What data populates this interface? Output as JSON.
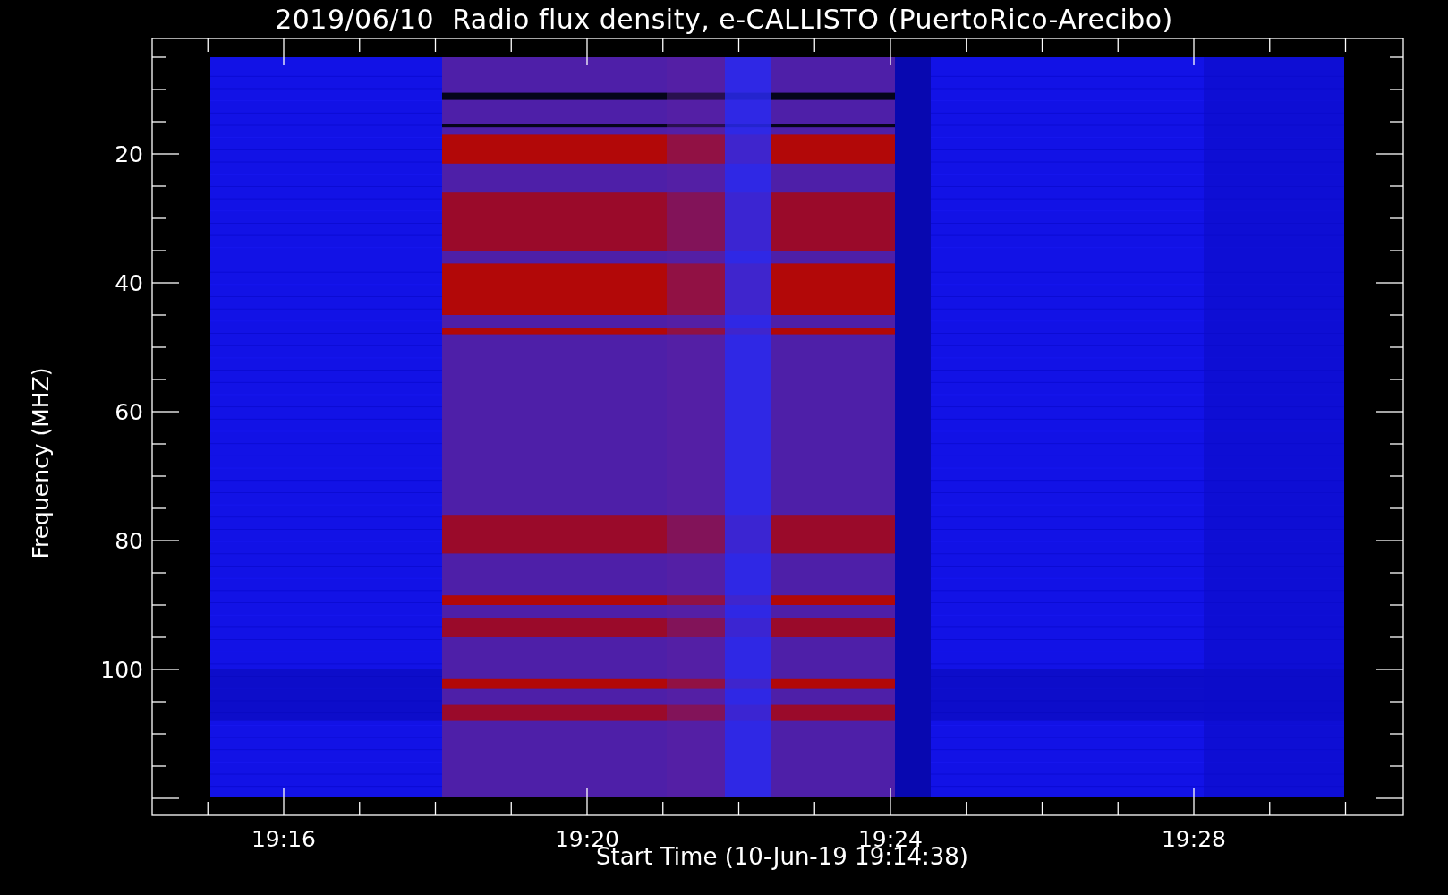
{
  "title": "2019/06/10  Radio flux density, e-CALLISTO (PuertoRico-Arecibo)",
  "plot": {
    "y_axis": {
      "label": "Frequency (MHZ)",
      "ticks": [
        "20",
        "40",
        "60",
        "80",
        "100"
      ]
    },
    "x_axis": {
      "label": "Start Time (10-Jun-19 19:14:38)",
      "ticks": [
        "19:16",
        "19:20",
        "19:24",
        "19:28"
      ]
    }
  }
}
